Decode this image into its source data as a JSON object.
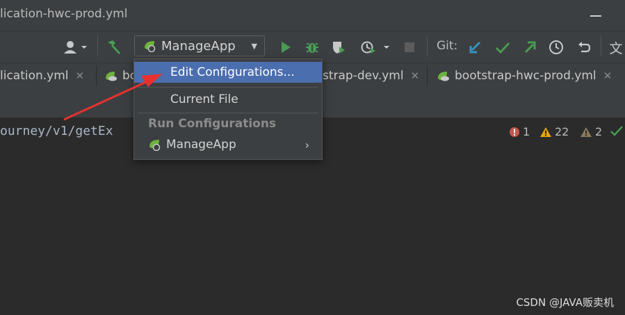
{
  "window": {
    "title": "lication-hwc-prod.yml"
  },
  "toolbar": {
    "run_config": "ManageApp",
    "git_label": "Git:",
    "icons": [
      "user-icon",
      "build-hammer-icon",
      "run-icon",
      "debug-icon",
      "coverage-icon",
      "profile-icon",
      "stop-icon",
      "git-update-icon",
      "git-commit-icon",
      "git-push-icon",
      "history-icon",
      "rollback-icon",
      "translate-icon"
    ]
  },
  "tabs": [
    {
      "label": "lication.yml"
    },
    {
      "label": "bo"
    },
    {
      "label": "strap-dev.yml"
    },
    {
      "label": "bootstrap-hwc-prod.yml"
    }
  ],
  "editor": {
    "code_line": "ourney/v1/getEx"
  },
  "inspections": {
    "errors": "1",
    "warnings": "22",
    "weak_warnings": "2"
  },
  "dropdown": {
    "items": {
      "edit_configurations": "Edit Configurations...",
      "current_file": "Current File",
      "run_config_header": "Run Configurations",
      "manage_app": "ManageApp"
    }
  },
  "watermark": "CSDN @JAVA贩卖机",
  "colors": {
    "accent": "#4b6eaf",
    "annotation_arrow": "#e8312f",
    "run_green": "#499c54",
    "git_blue": "#3592c4"
  }
}
